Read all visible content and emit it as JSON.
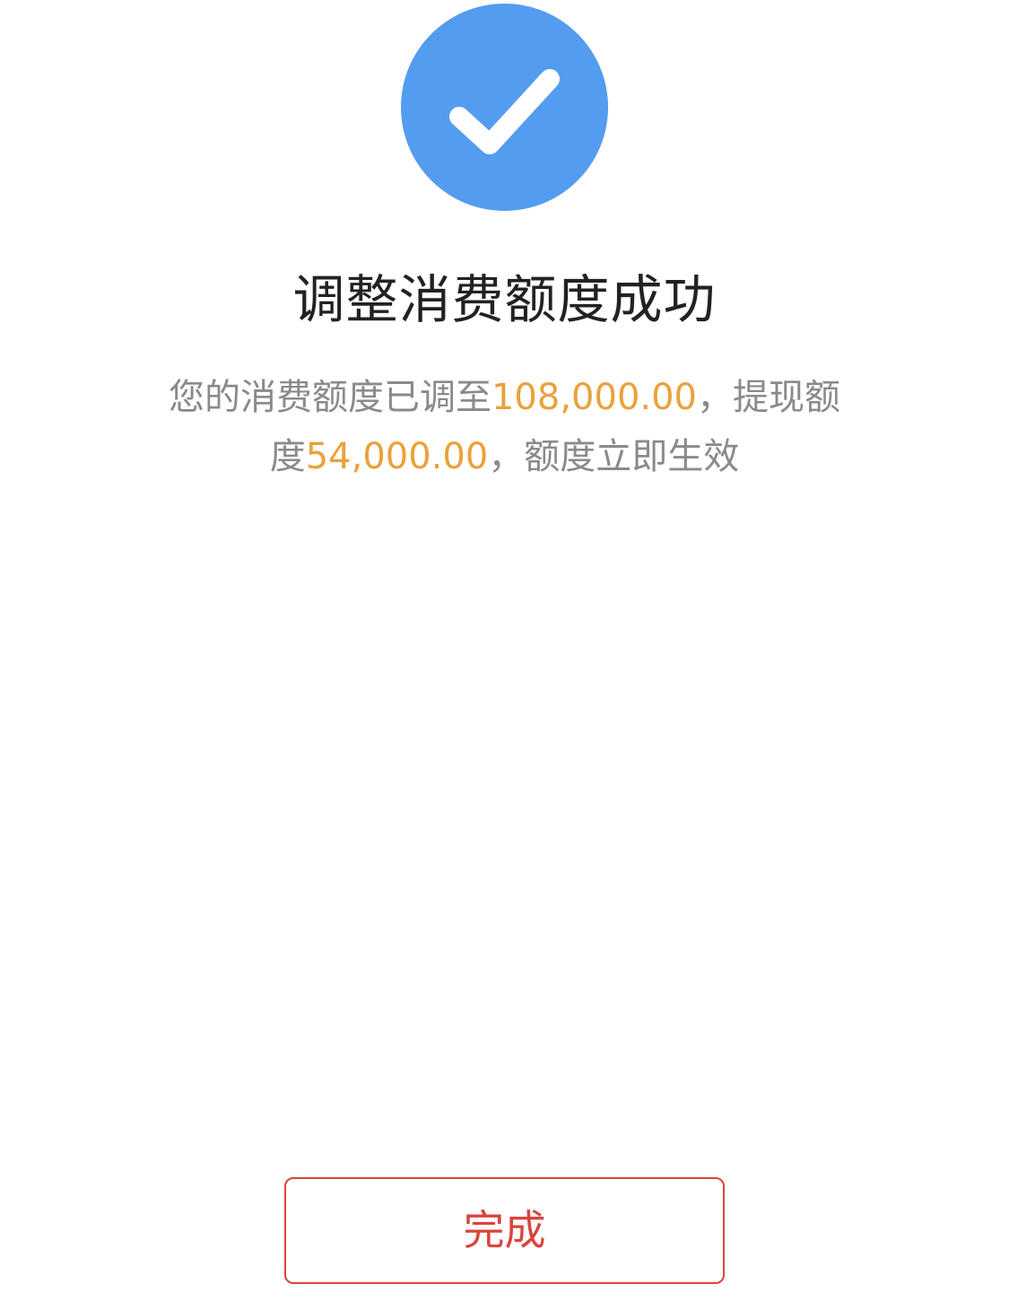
{
  "status_icon": {
    "name": "checkmark-icon",
    "color": "#549cef"
  },
  "title": "调整消费额度成功",
  "message": {
    "part1": "您的消费额度已调至",
    "consumption_limit": "108,000.00",
    "part2": "，提现额度",
    "withdrawal_limit": "54,000.00",
    "part3": "，额度立即生效"
  },
  "colors": {
    "accent": "#549cef",
    "amount": "#e9a23b",
    "button": "#d9443c"
  },
  "done_button_label": "完成"
}
